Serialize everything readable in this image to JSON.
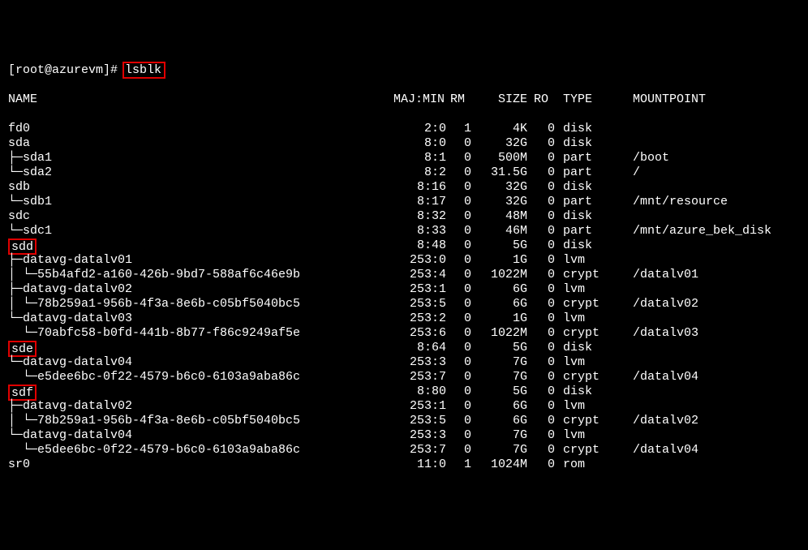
{
  "prompt": "[root@azurevm]# ",
  "command": "lsblk",
  "header": {
    "name": "NAME",
    "majmin": "MAJ:MIN",
    "rm": "RM",
    "size": "SIZE",
    "ro": "RO",
    "type": "TYPE",
    "mount": "MOUNTPOINT"
  },
  "rows": [
    {
      "name": "fd0",
      "maj": "2:0",
      "rm": "1",
      "size": "4K",
      "ro": "0",
      "type": "disk",
      "mount": ""
    },
    {
      "name": "sda",
      "maj": "8:0",
      "rm": "0",
      "size": "32G",
      "ro": "0",
      "type": "disk",
      "mount": ""
    },
    {
      "name": "├─sda1",
      "maj": "8:1",
      "rm": "0",
      "size": "500M",
      "ro": "0",
      "type": "part",
      "mount": "/boot"
    },
    {
      "name": "└─sda2",
      "maj": "8:2",
      "rm": "0",
      "size": "31.5G",
      "ro": "0",
      "type": "part",
      "mount": "/"
    },
    {
      "name": "sdb",
      "maj": "8:16",
      "rm": "0",
      "size": "32G",
      "ro": "0",
      "type": "disk",
      "mount": ""
    },
    {
      "name": "└─sdb1",
      "maj": "8:17",
      "rm": "0",
      "size": "32G",
      "ro": "0",
      "type": "part",
      "mount": "/mnt/resource"
    },
    {
      "name": "sdc",
      "maj": "8:32",
      "rm": "0",
      "size": "48M",
      "ro": "0",
      "type": "disk",
      "mount": ""
    },
    {
      "name": "└─sdc1",
      "maj": "8:33",
      "rm": "0",
      "size": "46M",
      "ro": "0",
      "type": "part",
      "mount": "/mnt/azure_bek_disk"
    },
    {
      "name": "sdd",
      "hl": true,
      "maj": "8:48",
      "rm": "0",
      "size": "5G",
      "ro": "0",
      "type": "disk",
      "mount": ""
    },
    {
      "name": "├─datavg-datalv01",
      "maj": "253:0",
      "rm": "0",
      "size": "1G",
      "ro": "0",
      "type": "lvm",
      "mount": ""
    },
    {
      "name": "│ └─55b4afd2-a160-426b-9bd7-588af6c46e9b",
      "maj": "253:4",
      "rm": "0",
      "size": "1022M",
      "ro": "0",
      "type": "crypt",
      "mount": "/datalv01"
    },
    {
      "name": "├─datavg-datalv02",
      "maj": "253:1",
      "rm": "0",
      "size": "6G",
      "ro": "0",
      "type": "lvm",
      "mount": ""
    },
    {
      "name": "│ └─78b259a1-956b-4f3a-8e6b-c05bf5040bc5",
      "maj": "253:5",
      "rm": "0",
      "size": "6G",
      "ro": "0",
      "type": "crypt",
      "mount": "/datalv02"
    },
    {
      "name": "└─datavg-datalv03",
      "maj": "253:2",
      "rm": "0",
      "size": "1G",
      "ro": "0",
      "type": "lvm",
      "mount": ""
    },
    {
      "name": "  └─70abfc58-b0fd-441b-8b77-f86c9249af5e",
      "maj": "253:6",
      "rm": "0",
      "size": "1022M",
      "ro": "0",
      "type": "crypt",
      "mount": "/datalv03"
    },
    {
      "name": "sde",
      "hl": true,
      "maj": "8:64",
      "rm": "0",
      "size": "5G",
      "ro": "0",
      "type": "disk",
      "mount": ""
    },
    {
      "name": "└─datavg-datalv04",
      "maj": "253:3",
      "rm": "0",
      "size": "7G",
      "ro": "0",
      "type": "lvm",
      "mount": ""
    },
    {
      "name": "  └─e5dee6bc-0f22-4579-b6c0-6103a9aba86c",
      "maj": "253:7",
      "rm": "0",
      "size": "7G",
      "ro": "0",
      "type": "crypt",
      "mount": "/datalv04"
    },
    {
      "name": "sdf",
      "hl": true,
      "maj": "8:80",
      "rm": "0",
      "size": "5G",
      "ro": "0",
      "type": "disk",
      "mount": ""
    },
    {
      "name": "├─datavg-datalv02",
      "maj": "253:1",
      "rm": "0",
      "size": "6G",
      "ro": "0",
      "type": "lvm",
      "mount": ""
    },
    {
      "name": "│ └─78b259a1-956b-4f3a-8e6b-c05bf5040bc5",
      "maj": "253:5",
      "rm": "0",
      "size": "6G",
      "ro": "0",
      "type": "crypt",
      "mount": "/datalv02"
    },
    {
      "name": "└─datavg-datalv04",
      "maj": "253:3",
      "rm": "0",
      "size": "7G",
      "ro": "0",
      "type": "lvm",
      "mount": ""
    },
    {
      "name": "  └─e5dee6bc-0f22-4579-b6c0-6103a9aba86c",
      "maj": "253:7",
      "rm": "0",
      "size": "7G",
      "ro": "0",
      "type": "crypt",
      "mount": "/datalv04"
    },
    {
      "name": "sr0",
      "maj": "11:0",
      "rm": "1",
      "size": "1024M",
      "ro": "0",
      "type": "rom",
      "mount": ""
    }
  ]
}
